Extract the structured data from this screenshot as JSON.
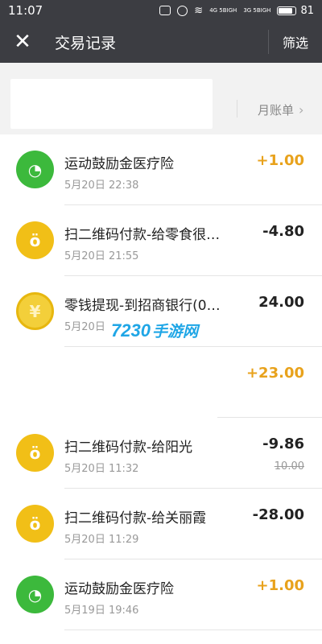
{
  "status": {
    "time": "11:07",
    "battery": "81",
    "net1": "4G 5BIGH",
    "net2": "3G 5BIGH"
  },
  "header": {
    "title": "交易记录",
    "filter": "筛选"
  },
  "summary": {
    "monthly_bill": "月账单"
  },
  "transactions": [
    {
      "name": "运动鼓励金医疗险",
      "time": "5月20日  22:38",
      "amount": "+1.00",
      "icon": "wechat-icon"
    },
    {
      "name": "扫二维码付款-给零食很…",
      "time": "5月20日  21:55",
      "amount": "-4.80",
      "icon": "money-bag-icon"
    },
    {
      "name": "零钱提现-到招商银行(0…",
      "time": "5月20日",
      "amount": "24.00",
      "icon": "yuan-coin-icon"
    },
    {
      "name": "扫二维码付款-给阳光",
      "time": "5月20日  11:32",
      "amount": "-9.86",
      "original": "10.00",
      "icon": "money-bag-icon"
    },
    {
      "name": "扫二维码付款-给关丽霞",
      "time": "5月20日  11:29",
      "amount": "-28.00",
      "icon": "money-bag-icon"
    },
    {
      "name": "运动鼓励金医疗险",
      "time": "5月19日  19:46",
      "amount": "+1.00",
      "icon": "wechat-icon"
    }
  ],
  "subtotal": "+23.00",
  "watermark": {
    "number": "7230",
    "text": "手游网"
  },
  "colors": {
    "header": "#3c3d42",
    "positive": "#e8a21c",
    "green": "#3cb93c",
    "yellow": "#f1bf17"
  }
}
